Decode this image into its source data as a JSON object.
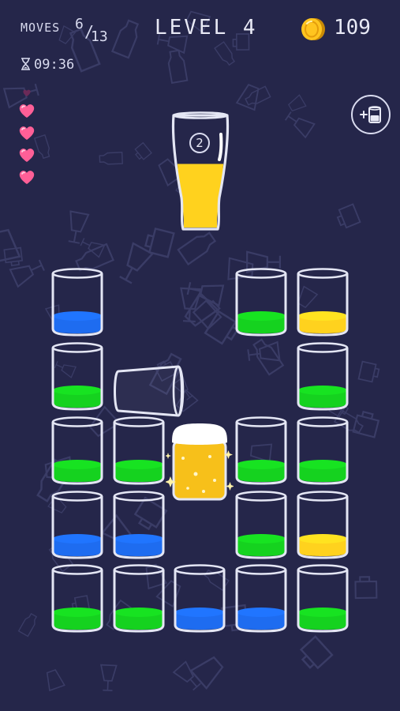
{
  "hud": {
    "moves_label": "MOVES",
    "moves_used": "6",
    "moves_total": "13",
    "level_label": "LEVEL 4",
    "coins": "109",
    "timer": "09:36",
    "lives": 4
  },
  "colors": {
    "background": "#25264a",
    "blue": "#1e6cf0",
    "green": "#15d21f",
    "yellow": "#ffd21e",
    "beer": "#f7c01a",
    "heart": "#ff5f97",
    "glass_outline": "#e4e6f4"
  },
  "target": {
    "remaining": "2",
    "color": "yellow",
    "fill_level": 0.55
  },
  "icons": {
    "add_glass": "add-glass-icon",
    "coin": "coin-icon",
    "timer": "hourglass-icon",
    "life": "heart-icon"
  },
  "board": {
    "rows": [
      [
        "blue",
        null,
        null,
        "green",
        "yellow"
      ],
      [
        "green",
        null,
        null,
        null,
        "green"
      ],
      [
        "green",
        "green",
        "beer",
        "green",
        "green"
      ],
      [
        "blue",
        "blue",
        null,
        "green",
        "yellow"
      ],
      [
        "green",
        "green",
        "blue",
        "blue",
        "green"
      ]
    ],
    "empty_cells": [
      [
        1,
        1
      ],
      [
        1,
        2
      ],
      [
        1,
        3
      ],
      [
        0,
        1
      ],
      [
        0,
        2
      ]
    ],
    "tipped_glass": "empty",
    "active_glass": "beer"
  }
}
